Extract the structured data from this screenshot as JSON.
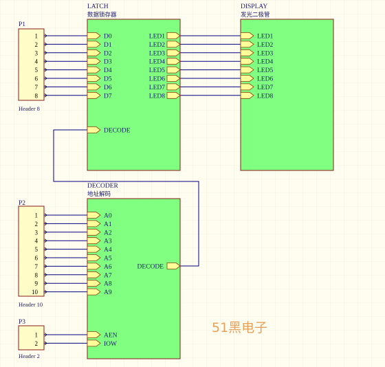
{
  "colors": {
    "background": "#fffdf0",
    "grid": "#ece8cf",
    "block_fill": "#80ff80",
    "block_border": "#8b1a1a",
    "port_fill": "#ffff99",
    "port_border": "#8b3a10",
    "header_fill": "#fffcc8",
    "wire": "#000080",
    "label": "#1a1a6e",
    "watermark": "#e8a15a"
  },
  "blocks": {
    "latch": {
      "name": "LATCH",
      "subtitle": "数据锁存器",
      "inputs": [
        "D0",
        "D1",
        "D2",
        "D3",
        "D4",
        "D5",
        "D6",
        "D7"
      ],
      "decode_input": "DECODE",
      "outputs": [
        "LED1",
        "LED2",
        "LED3",
        "LED4",
        "LED5",
        "LED6",
        "LED7",
        "LED8"
      ]
    },
    "display": {
      "name": "DISPLAY",
      "subtitle": "发光二极管",
      "inputs": [
        "LED1",
        "LED2",
        "LED3",
        "LED4",
        "LED5",
        "LED6",
        "LED7",
        "LED8"
      ]
    },
    "decoder": {
      "name": "DECODER",
      "subtitle": "地址解码",
      "inputs": [
        "A0",
        "A1",
        "A2",
        "A3",
        "A4",
        "A5",
        "A6",
        "A7",
        "A8",
        "A9"
      ],
      "control_inputs": [
        "AEN",
        "IOW"
      ],
      "output": "DECODE"
    }
  },
  "headers": {
    "p1": {
      "name": "P1",
      "label": "Header 8",
      "pins": [
        "1",
        "2",
        "3",
        "4",
        "5",
        "6",
        "7",
        "8"
      ]
    },
    "p2": {
      "name": "P2",
      "label": "Header 10",
      "pins": [
        "1",
        "2",
        "3",
        "4",
        "5",
        "6",
        "7",
        "8",
        "9",
        "10"
      ]
    },
    "p3": {
      "name": "P3",
      "label": "Header 2",
      "pins": [
        "1",
        "2"
      ]
    }
  },
  "watermark": "51黑电子"
}
